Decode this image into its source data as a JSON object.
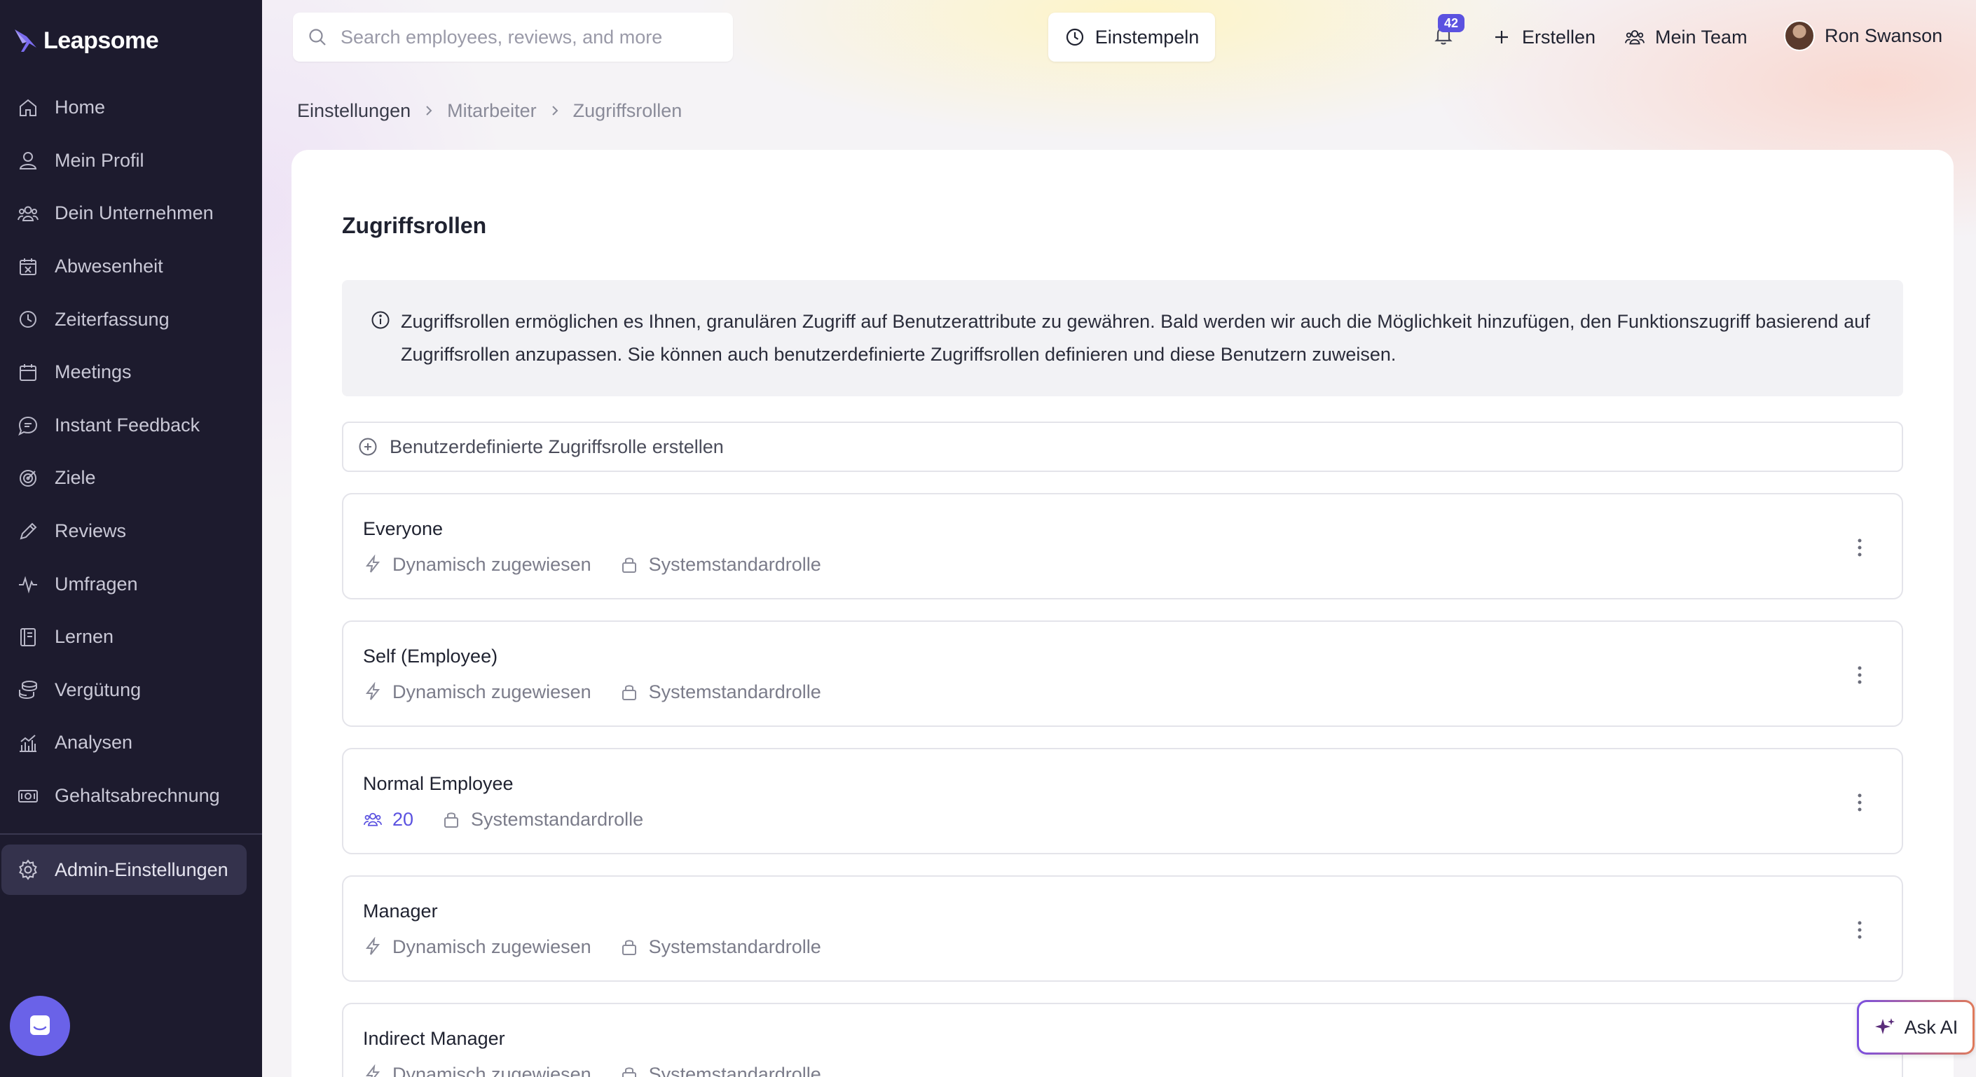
{
  "app": {
    "brand": "Leapsome"
  },
  "sidebar": {
    "items": [
      {
        "label": "Home",
        "icon": "home-icon"
      },
      {
        "label": "Mein Profil",
        "icon": "user-icon"
      },
      {
        "label": "Dein Unternehmen",
        "icon": "users-icon"
      },
      {
        "label": "Abwesenheit",
        "icon": "calendar-x-icon"
      },
      {
        "label": "Zeiterfassung",
        "icon": "clock-icon"
      },
      {
        "label": "Meetings",
        "icon": "calendar-icon"
      },
      {
        "label": "Instant Feedback",
        "icon": "chat-icon"
      },
      {
        "label": "Ziele",
        "icon": "target-icon"
      },
      {
        "label": "Reviews",
        "icon": "pencil-icon"
      },
      {
        "label": "Umfragen",
        "icon": "pulse-icon"
      },
      {
        "label": "Lernen",
        "icon": "book-icon"
      },
      {
        "label": "Vergütung",
        "icon": "coins-icon"
      },
      {
        "label": "Analysen",
        "icon": "chart-icon"
      },
      {
        "label": "Gehaltsabrechnung",
        "icon": "money-icon"
      }
    ],
    "admin": {
      "label": "Admin-Einstellungen",
      "icon": "gear-icon"
    }
  },
  "header": {
    "search_placeholder": "Search employees, reviews, and more",
    "clock_in_label": "Einstempeln",
    "notification_count": "42",
    "create_label": "Erstellen",
    "team_label": "Mein Team",
    "user_name": "Ron Swanson"
  },
  "breadcrumb": [
    "Einstellungen",
    "Mitarbeiter",
    "Zugriffsrollen"
  ],
  "main": {
    "title": "Zugriffsrollen",
    "info": "Zugriffsrollen ermöglichen es Ihnen, granulären Zugriff auf Benutzerattribute zu gewähren. Bald werden wir auch die Möglichkeit hinzufügen, den Funktionszugriff basierend auf Zugriffsrollen anzupassen. Sie können auch benutzerdefinierte Zugriffsrollen definieren und diese Benutzern zuweisen.",
    "create_label": "Benutzerdefinierte Zugriffsrolle erstellen",
    "roles": [
      {
        "name": "Everyone",
        "assignment": "Dynamisch zugewiesen",
        "type": "Systemstandardrolle"
      },
      {
        "name": "Self (Employee)",
        "assignment": "Dynamisch zugewiesen",
        "type": "Systemstandardrolle"
      },
      {
        "name": "Normal Employee",
        "assignment": "20",
        "type": "Systemstandardrolle"
      },
      {
        "name": "Manager",
        "assignment": "Dynamisch zugewiesen",
        "type": "Systemstandardrolle"
      },
      {
        "name": "Indirect Manager",
        "assignment": "Dynamisch zugewiesen",
        "type": "Systemstandardrolle"
      }
    ]
  },
  "ask_ai_label": "Ask AI",
  "colors": {
    "sidebar": "#1d1b2e",
    "accent": "#5b52e0",
    "admin_active": "#34324c"
  }
}
